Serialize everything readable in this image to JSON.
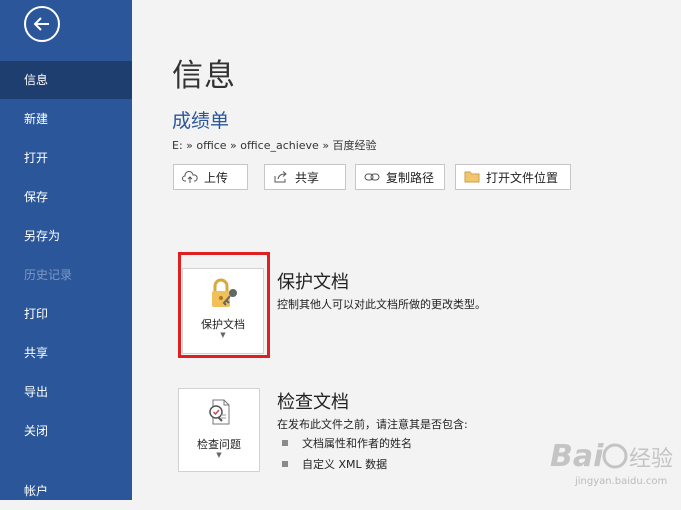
{
  "sidebar": {
    "items": [
      {
        "label": "信息",
        "active": true
      },
      {
        "label": "新建"
      },
      {
        "label": "打开"
      },
      {
        "label": "保存"
      },
      {
        "label": "另存为"
      },
      {
        "label": "历史记录",
        "disabled": true
      },
      {
        "label": "打印"
      },
      {
        "label": "共享"
      },
      {
        "label": "导出"
      },
      {
        "label": "关闭"
      },
      {
        "label": "帐户"
      }
    ]
  },
  "main": {
    "title": "信息",
    "doc_name": "成绩单",
    "breadcrumb": "E: » office » office_achieve » 百度经验",
    "buttons": {
      "upload": "上传",
      "share": "共享",
      "copy_path": "复制路径",
      "open_location": "打开文件位置"
    },
    "protect": {
      "tile_label": "保护文档",
      "title": "保护文档",
      "desc": "控制其他人可以对此文档所做的更改类型。"
    },
    "inspect": {
      "tile_label": "检查问题",
      "title": "检查文档",
      "desc": "在发布此文件之前，请注意其是否包含:",
      "bullets": [
        "文档属性和作者的姓名",
        "自定义 XML 数据"
      ]
    }
  },
  "watermark": {
    "brand": "Bai",
    "brand2": "经验",
    "url": "jingyan.baidu.com"
  },
  "colors": {
    "sidebar": "#2b579a",
    "accent": "#2b579a",
    "highlight": "#e02020",
    "background": "#f3f3f3"
  }
}
